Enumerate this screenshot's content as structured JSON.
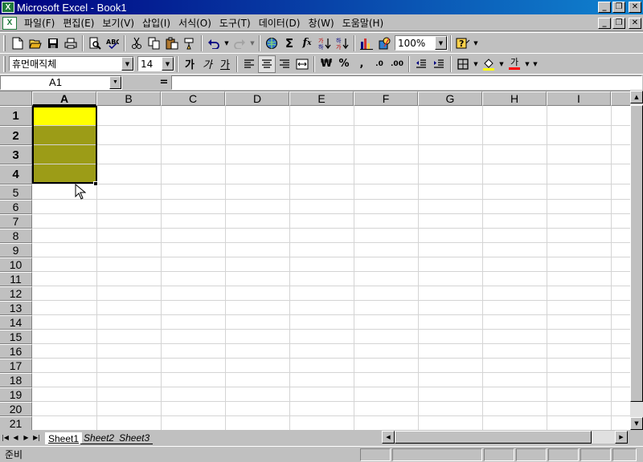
{
  "window": {
    "title": "Microsoft Excel - Book1",
    "app_icon": "excel-icon",
    "buttons": [
      "minimize-icon",
      "restore-icon",
      "close-icon"
    ]
  },
  "menubar": {
    "items": [
      "파일(F)",
      "편집(E)",
      "보기(V)",
      "삽입(I)",
      "서식(O)",
      "도구(T)",
      "데이터(D)",
      "창(W)",
      "도움말(H)"
    ]
  },
  "standard_toolbar": {
    "icons": [
      "new-icon",
      "open-icon",
      "save-icon",
      "print-icon",
      "print-preview-icon",
      "spelling-icon",
      "cut-icon",
      "copy-icon",
      "paste-icon",
      "format-painter-icon",
      "undo-icon",
      "redo-icon",
      "hyperlink-icon",
      "autosum-icon",
      "function-icon",
      "sort-ascending-icon",
      "sort-descending-icon",
      "chart-wizard-icon",
      "drawing-icon",
      "help-icon"
    ],
    "zoom": "100%"
  },
  "formatting_toolbar": {
    "font_name": "휴먼매직체",
    "font_size": "14",
    "bold": "가",
    "italic": "가",
    "underline": "가",
    "currency": "₩",
    "percent": "%",
    "comma": ",",
    "increase_decimal": ".0",
    "decrease_decimal": ".00",
    "font_color_label": "가",
    "fill_color": "#ffff00",
    "font_color": "#ff0000"
  },
  "formula_bar": {
    "name_box": "A1",
    "equals": "=",
    "value": ""
  },
  "grid": {
    "columns": [
      "A",
      "B",
      "C",
      "D",
      "E",
      "F",
      "G",
      "H",
      "I"
    ],
    "rows": [
      "1",
      "2",
      "3",
      "4",
      "5",
      "6",
      "7",
      "8",
      "9",
      "10",
      "11",
      "12",
      "13",
      "14",
      "15",
      "16",
      "17",
      "18",
      "19",
      "20",
      "21"
    ],
    "selected_column": "A",
    "selected_rows": [
      "1",
      "2",
      "3",
      "4"
    ],
    "selection_range": "A1:A4",
    "active_cell_color": "#ffff00",
    "selected_cell_color": "#9c9c17"
  },
  "sheets": {
    "tabs": [
      "Sheet1",
      "Sheet2",
      "Sheet3"
    ],
    "active": "Sheet1"
  },
  "status": {
    "text": "준비"
  }
}
